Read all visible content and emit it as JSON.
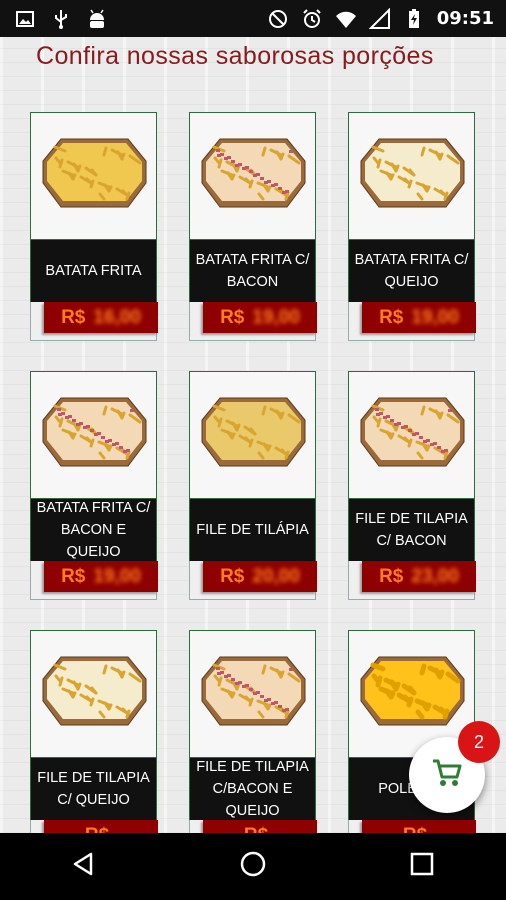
{
  "status_bar": {
    "time": "09:51",
    "left_icons": [
      "image-icon",
      "usb-icon",
      "android-icon"
    ],
    "right_icons": [
      "do-not-disturb-icon",
      "alarm-icon",
      "wifi-icon",
      "signal-icon",
      "battery-charging-icon"
    ]
  },
  "page": {
    "title": "Confira nossas saborosas porções"
  },
  "products": [
    {
      "name": "BATATA FRITA",
      "currency": "R$",
      "price": "16,00",
      "food": "fries"
    },
    {
      "name": "BATATA FRITA C/ BACON",
      "currency": "R$",
      "price": "19,00",
      "food": "bacon"
    },
    {
      "name": "BATATA FRITA C/ QUEIJO",
      "currency": "R$",
      "price": "19,00",
      "food": "cheese"
    },
    {
      "name": "BATATA FRITA C/ BACON E QUEIJO",
      "currency": "R$",
      "price": "19,00",
      "food": "bacon"
    },
    {
      "name": "FILE DE TILÁPIA",
      "currency": "R$",
      "price": "20,00",
      "food": "tilapia"
    },
    {
      "name": "FILE DE TILAPIA C/ BACON",
      "currency": "R$",
      "price": "23,00",
      "food": "bacon"
    },
    {
      "name": "FILE DE TILAPIA C/ QUEIJO",
      "currency": "R$",
      "price": "",
      "food": "cheese"
    },
    {
      "name": "FILE DE TILAPIA C/BACON E QUEIJO",
      "currency": "R$",
      "price": "",
      "food": "bacon"
    },
    {
      "name": "POLENTA",
      "currency": "R$",
      "price": "",
      "food": "polenta"
    }
  ],
  "cart": {
    "count": "2",
    "icon": "cart-icon"
  },
  "nav_bar": {
    "icons": [
      "back-icon",
      "home-icon",
      "recents-icon"
    ]
  },
  "colors": {
    "title": "#8b1a1a",
    "price_bg": "#8f0000",
    "price_text": "#ff7a1a",
    "badge": "#d81414",
    "card_border": "#2e6b3a"
  }
}
